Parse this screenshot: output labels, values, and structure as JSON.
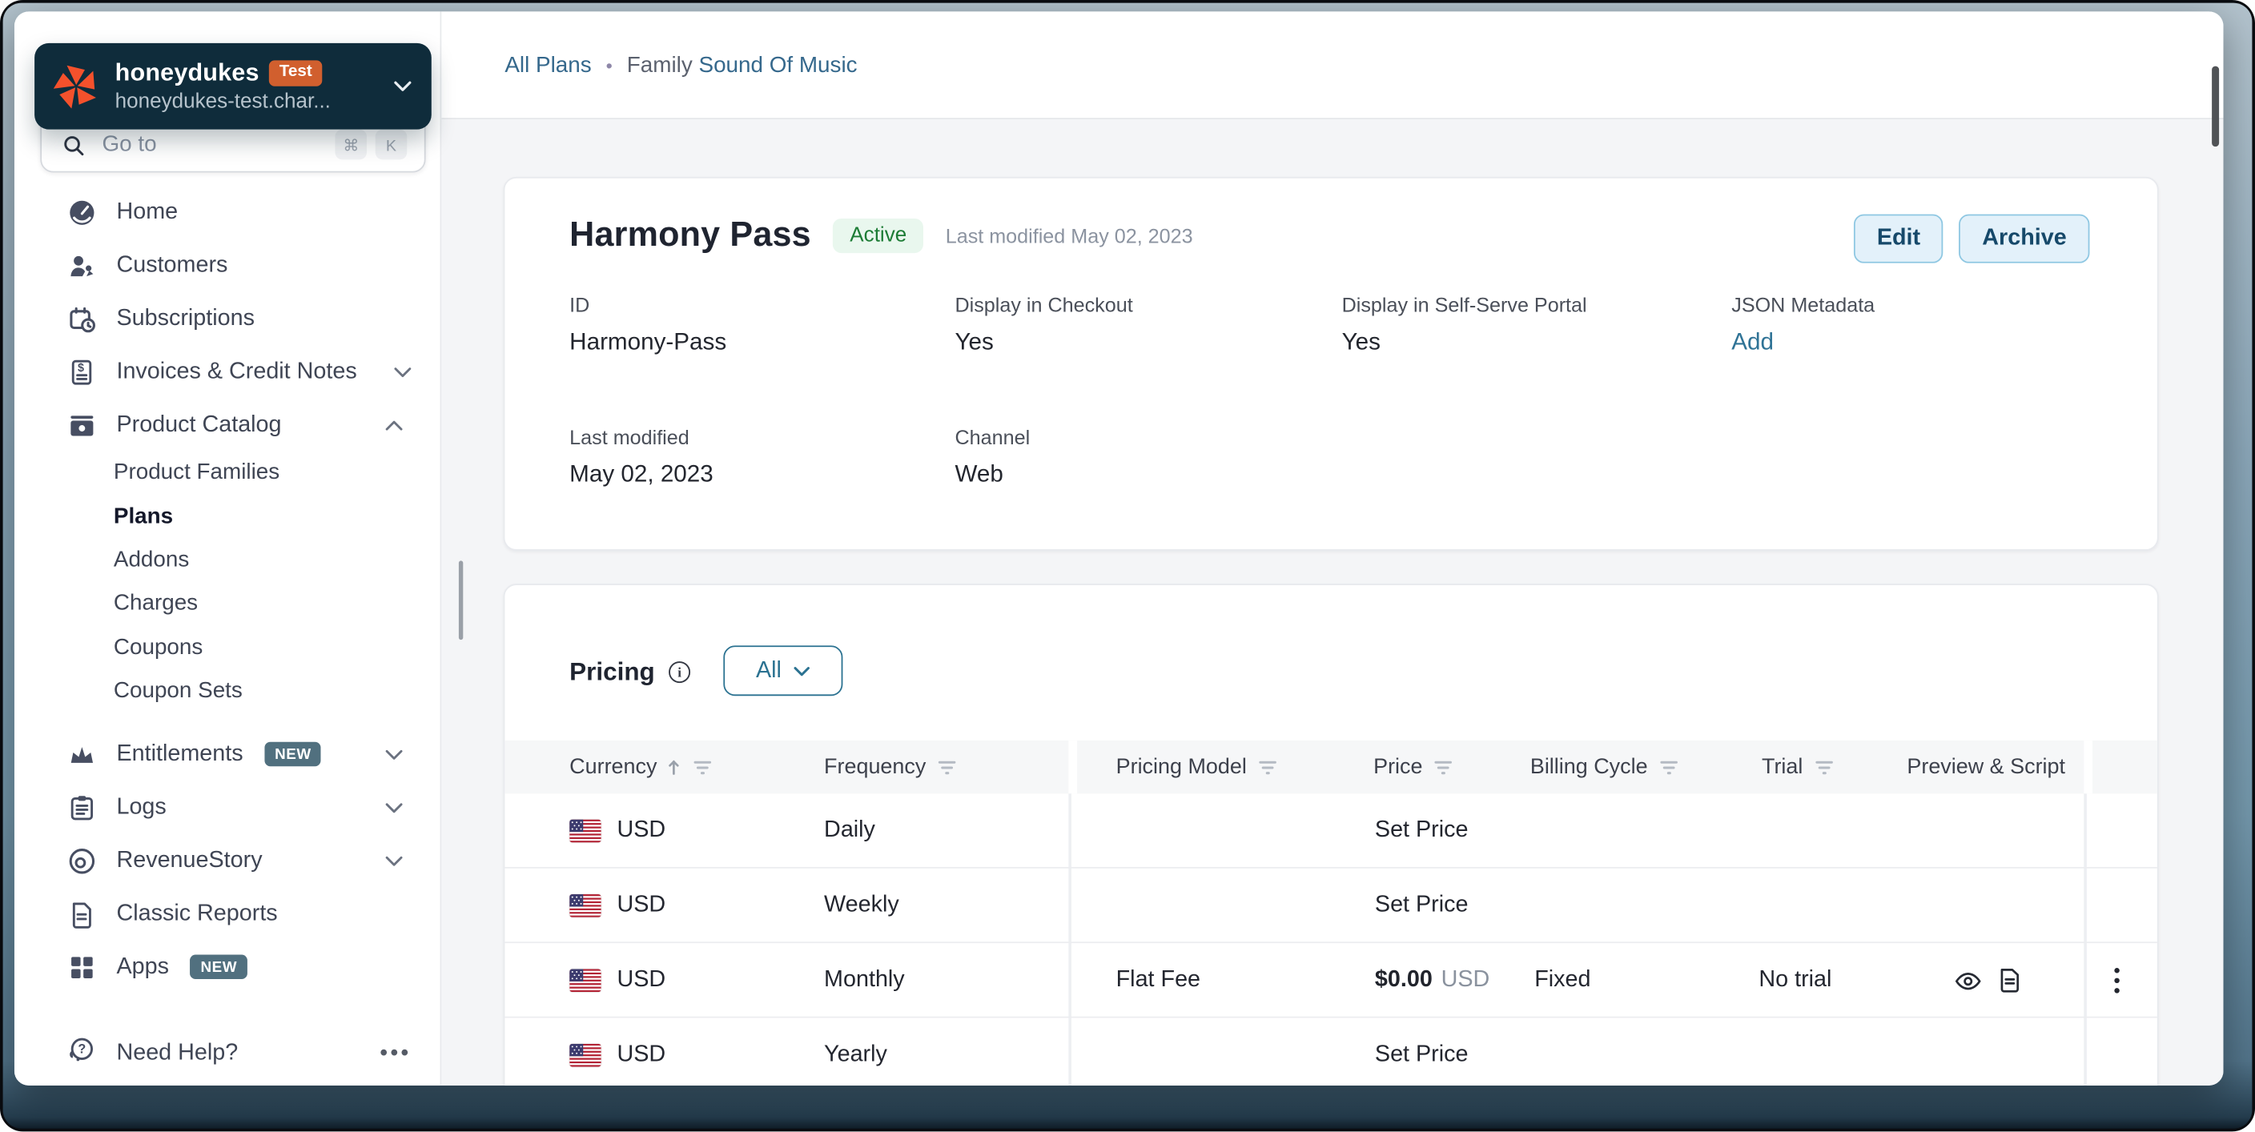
{
  "sidebar": {
    "account": {
      "name": "honeydukes",
      "env_badge": "Test",
      "domain": "honeydukes-test.char...",
      "logo": "chargebee-pinwheel"
    },
    "goto": {
      "label": "Go to",
      "shortcut_keys": [
        "⌘",
        "K"
      ]
    },
    "items": [
      {
        "label": "Home",
        "icon": "dashboard-icon"
      },
      {
        "label": "Customers",
        "icon": "customers-icon"
      },
      {
        "label": "Subscriptions",
        "icon": "subscriptions-icon"
      },
      {
        "label": "Invoices & Credit Notes",
        "icon": "invoice-icon",
        "chevron": "down"
      },
      {
        "label": "Product Catalog",
        "icon": "product-catalog-icon",
        "chevron": "up",
        "expanded": true
      },
      {
        "label": "Product Families",
        "sub": true
      },
      {
        "label": "Plans",
        "sub": true,
        "active": true
      },
      {
        "label": "Addons",
        "sub": true
      },
      {
        "label": "Charges",
        "sub": true
      },
      {
        "label": "Coupons",
        "sub": true
      },
      {
        "label": "Coupon Sets",
        "sub": true
      },
      {
        "label": "Entitlements",
        "icon": "crown-icon",
        "badge": "NEW",
        "chevron": "down"
      },
      {
        "label": "Logs",
        "icon": "logs-icon",
        "chevron": "down"
      },
      {
        "label": "RevenueStory",
        "icon": "revenuestory-icon",
        "chevron": "down"
      },
      {
        "label": "Classic Reports",
        "icon": "reports-icon"
      },
      {
        "label": "Apps",
        "icon": "apps-icon",
        "badge": "NEW"
      }
    ],
    "help": {
      "label": "Need Help?",
      "more": "•••"
    }
  },
  "header": {
    "breadcrumb": {
      "root": "All Plans",
      "separator": "•",
      "current_prefix": "Family",
      "current_name": "Sound Of Music"
    }
  },
  "plan": {
    "title": "Harmony Pass",
    "status": "Active",
    "modified_note": "Last modified May 02, 2023",
    "actions": {
      "edit": "Edit",
      "archive": "Archive"
    },
    "id": {
      "label": "ID",
      "value": "Harmony-Pass"
    },
    "checkout": {
      "label": "Display in Checkout",
      "value": "Yes"
    },
    "portal": {
      "label": "Display in Self-Serve Portal",
      "value": "Yes"
    },
    "json_metadata": {
      "label": "JSON Metadata",
      "action": "Add"
    },
    "last_modified": {
      "label": "Last modified",
      "value": "May 02, 2023"
    },
    "channel": {
      "label": "Channel",
      "value": "Web"
    }
  },
  "pricing": {
    "title": "Pricing",
    "filter_all": "All",
    "columns": {
      "currency": "Currency",
      "frequency": "Frequency",
      "pricing_model": "Pricing Model",
      "price": "Price",
      "billing_cycle": "Billing Cycle",
      "trial": "Trial",
      "preview": "Preview & Script"
    },
    "rows": [
      {
        "currency": "USD",
        "frequency": "Daily",
        "set_price": "Set Price"
      },
      {
        "currency": "USD",
        "frequency": "Weekly",
        "set_price": "Set Price"
      },
      {
        "currency": "USD",
        "frequency": "Monthly",
        "pricing_model": "Flat Fee",
        "price": "$0.00",
        "price_currency": "USD",
        "billing_cycle": "Fixed",
        "trial": "No trial"
      },
      {
        "currency": "USD",
        "frequency": "Yearly",
        "set_price": "Set Price"
      }
    ]
  },
  "colors": {
    "accent_link": "#2f7396",
    "brand_navy": "#0f2c3b",
    "brand_orange": "#f4512c",
    "test_badge": "#d15f2e",
    "new_badge": "#51707f",
    "status_active_bg": "#e9f7ee",
    "status_active_text": "#1d7c35",
    "button_bg": "#e3f1fa",
    "button_border": "#8ec7e2",
    "button_text": "#16496a"
  }
}
